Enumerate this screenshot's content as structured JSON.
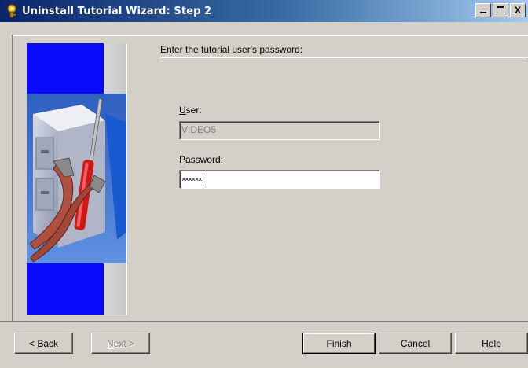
{
  "window": {
    "title": "Uninstall Tutorial Wizard: Step 2",
    "controls": {
      "minimize": "_",
      "maximize": "□",
      "close": "X"
    }
  },
  "main": {
    "heading": "Enter the tutorial user's password:",
    "user": {
      "label_mnemonic": "U",
      "label_rest": "ser:",
      "value": "VIDEO5",
      "enabled": false
    },
    "password": {
      "label_mnemonic": "P",
      "label_rest": "assword:",
      "value": "××××××",
      "enabled": true
    }
  },
  "buttons": {
    "back": {
      "prefix": "< ",
      "mnemonic": "B",
      "rest": "ack"
    },
    "next": {
      "mnemonic": "N",
      "rest": "ext >",
      "enabled": false
    },
    "finish": {
      "label": "Finish"
    },
    "cancel": {
      "label": "Cancel"
    },
    "help": {
      "mnemonic": "H",
      "rest": "elp"
    }
  },
  "icons": {
    "title_icon": "wizard-key-icon",
    "side_art": "filing-cabinet-with-tools-icon"
  },
  "colors": {
    "title_bar_start": "#0a246a",
    "title_bar_end": "#a6caf0",
    "side_blue": "#0000ff",
    "dialog_face": "#d4d0c8"
  }
}
